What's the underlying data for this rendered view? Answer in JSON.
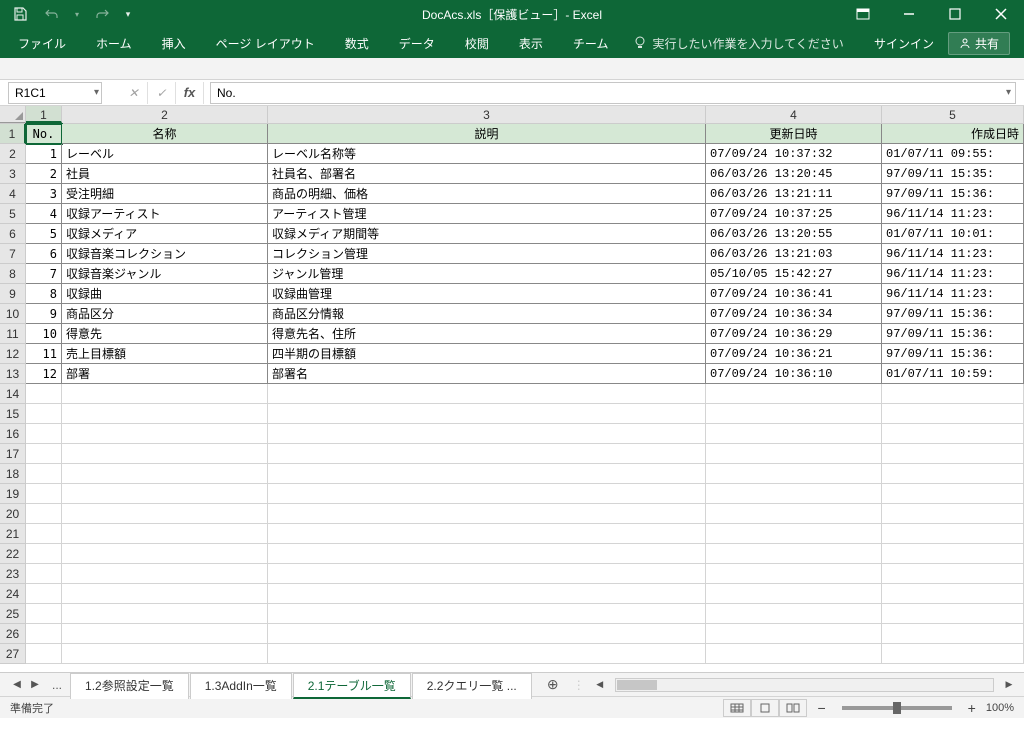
{
  "window": {
    "title": "DocAcs.xls［保護ビュー］- Excel",
    "sign_in": "サインイン",
    "share": "共有"
  },
  "ribbon": {
    "tabs": [
      "ファイル",
      "ホーム",
      "挿入",
      "ページ レイアウト",
      "数式",
      "データ",
      "校閲",
      "表示",
      "チーム"
    ],
    "tell_me": "実行したい作業を入力してください"
  },
  "formula_bar": {
    "name_box": "R1C1",
    "value": "No."
  },
  "columns": [
    "1",
    "2",
    "3",
    "4",
    "5"
  ],
  "header_row": [
    "No.",
    "名称",
    "説明",
    "更新日時",
    "作成日時"
  ],
  "data_rows": [
    {
      "no": "1",
      "name": "レーベル",
      "desc": "レーベル名称等",
      "upd": "07/09/24 10:37:32",
      "crt": "01/07/11 09:55:"
    },
    {
      "no": "2",
      "name": "社員",
      "desc": "社員名、部署名",
      "upd": "06/03/26 13:20:45",
      "crt": "97/09/11 15:35:"
    },
    {
      "no": "3",
      "name": "受注明細",
      "desc": "商品の明細、価格",
      "upd": "06/03/26 13:21:11",
      "crt": "97/09/11 15:36:"
    },
    {
      "no": "4",
      "name": "収録アーティスト",
      "desc": "アーティスト管理",
      "upd": "07/09/24 10:37:25",
      "crt": "96/11/14 11:23:"
    },
    {
      "no": "5",
      "name": "収録メディア",
      "desc": "収録メディア期間等",
      "upd": "06/03/26 13:20:55",
      "crt": "01/07/11 10:01:"
    },
    {
      "no": "6",
      "name": "収録音楽コレクション",
      "desc": "コレクション管理",
      "upd": "06/03/26 13:21:03",
      "crt": "96/11/14 11:23:"
    },
    {
      "no": "7",
      "name": "収録音楽ジャンル",
      "desc": "ジャンル管理",
      "upd": "05/10/05 15:42:27",
      "crt": "96/11/14 11:23:"
    },
    {
      "no": "8",
      "name": "収録曲",
      "desc": "収録曲管理",
      "upd": "07/09/24 10:36:41",
      "crt": "96/11/14 11:23:"
    },
    {
      "no": "9",
      "name": "商品区分",
      "desc": "商品区分情報",
      "upd": "07/09/24 10:36:34",
      "crt": "97/09/11 15:36:"
    },
    {
      "no": "10",
      "name": "得意先",
      "desc": "得意先名、住所",
      "upd": "07/09/24 10:36:29",
      "crt": "97/09/11 15:36:"
    },
    {
      "no": "11",
      "name": "売上目標額",
      "desc": "四半期の目標額",
      "upd": "07/09/24 10:36:21",
      "crt": "97/09/11 15:36:"
    },
    {
      "no": "12",
      "name": "部署",
      "desc": "部署名",
      "upd": "07/09/24 10:36:10",
      "crt": "01/07/11 10:59:"
    }
  ],
  "empty_rows": 14,
  "sheet_tabs": {
    "tabs": [
      "1.2参照設定一覧",
      "1.3AddIn一覧",
      "2.1テーブル一覧",
      "2.2クエリ一覧 ..."
    ],
    "active_index": 2,
    "ellipsis": "..."
  },
  "status": {
    "ready": "準備完了",
    "zoom": "100%"
  }
}
